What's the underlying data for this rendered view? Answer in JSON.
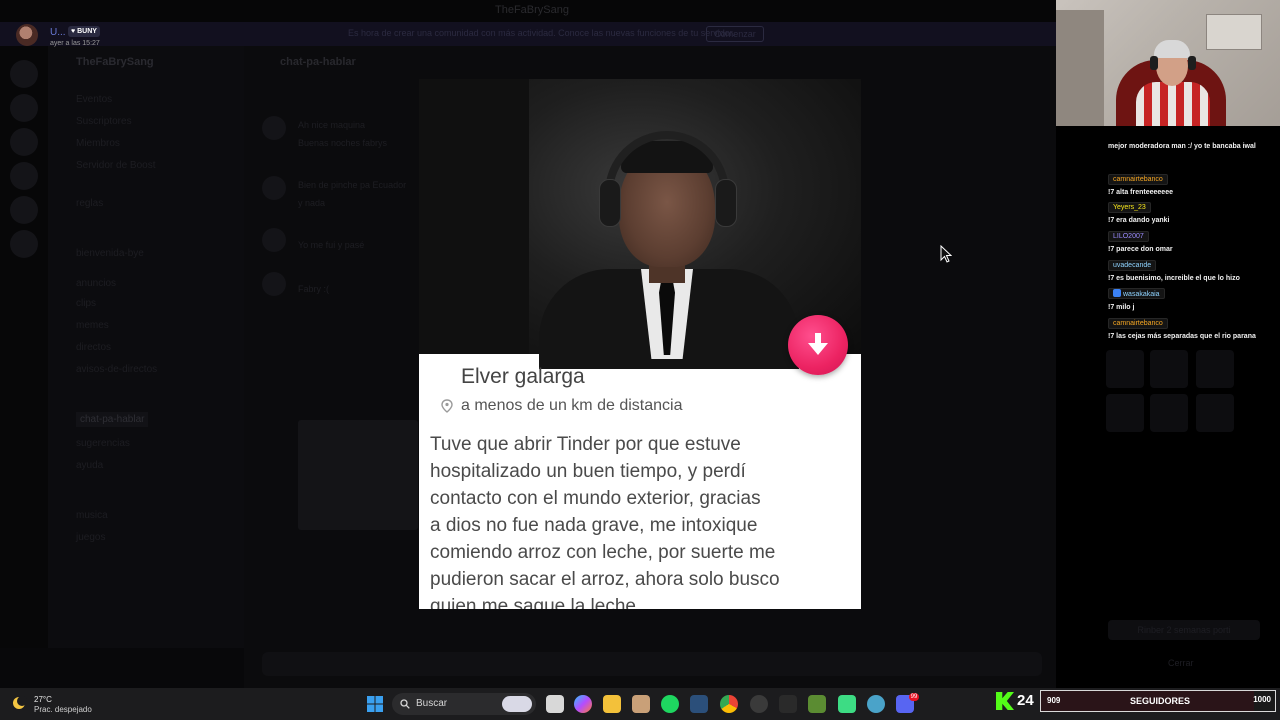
{
  "window": {
    "title": "TheFaBrySang"
  },
  "banner": {
    "text": "Es hora de crear una comunidad con más actividad. Conoce las nuevas funciones de tu servidor.",
    "button": "Comenzar"
  },
  "notification": {
    "user": "U...",
    "badge": "BUNY",
    "time": "ayer a las 15:27"
  },
  "sidebar": {
    "server": "TheFaBrySang",
    "channels": [
      "Eventos",
      "Suscriptores",
      "Miembros",
      "Servidor de Boost",
      "reglas",
      "bienvenida-bye",
      "anuncios",
      "clips",
      "memes",
      "directos",
      "avisos-de-directos",
      "chat-pa-hablar",
      "sugerencias",
      "ayuda",
      "musica",
      "juegos"
    ]
  },
  "chat": {
    "header": "chat-pa-hablar",
    "lines": [
      "Ah nice maquina",
      "Buenas noches fabrys",
      "Bien de pinche pa Ecuador",
      "y nada",
      "Yo me fui y pasé",
      "Fabry :("
    ]
  },
  "stream_chat": [
    {
      "user": "",
      "text": "mejor moderadora man :/ yo te bancaba iwal",
      "color": "#ffffff"
    },
    {
      "user": "camnairtebanco",
      "text": "!7 alta frenteeeeeee",
      "color": "#f5a623"
    },
    {
      "user": "Yeyers_23",
      "text": "!7 era dando yanki",
      "color": "#f8e71c"
    },
    {
      "user": "LILO2007",
      "text": "!7 parece don omar",
      "color": "#9b8cff"
    },
    {
      "user": "uvadecande",
      "text": "!7 es buenisimo, increible el que lo hizo",
      "color": "#8fd3ff"
    },
    {
      "user": "wasakakaia",
      "text": "!7 milo j",
      "color": "#8fd3ff"
    },
    {
      "user": "camnairtebanco",
      "text": "!7 las cejas más separadas que el rio parana",
      "color": "#f5a623"
    }
  ],
  "profile": {
    "name": "Elver galarga",
    "distance": "a menos de un km de distancia",
    "bio": "Tuve que abrir Tinder por que estuve\nhospitalizado un buen tiempo, y perdí\ncontacto con el mundo exterior, gracias\na dios no fue nada grave, me intoxique\ncomiendo arroz con leche, por suerte me\npudieron sacar el arroz, ahora solo busco\nquien me saque la leche"
  },
  "taskbar": {
    "temperature": "27°C",
    "condition": "Prac. despejado",
    "search_placeholder": "Buscar"
  },
  "followers": {
    "kick_count": "24",
    "current": "909",
    "label": "SEGUIDORES",
    "goal": "1000",
    "progress": 0.909
  },
  "dim_overlay": {
    "button": "Rinber 2 semanas porti",
    "close": "Cerrar"
  },
  "colors": {
    "accent_pink": "#ec2362",
    "kick_green": "#53fc18"
  }
}
